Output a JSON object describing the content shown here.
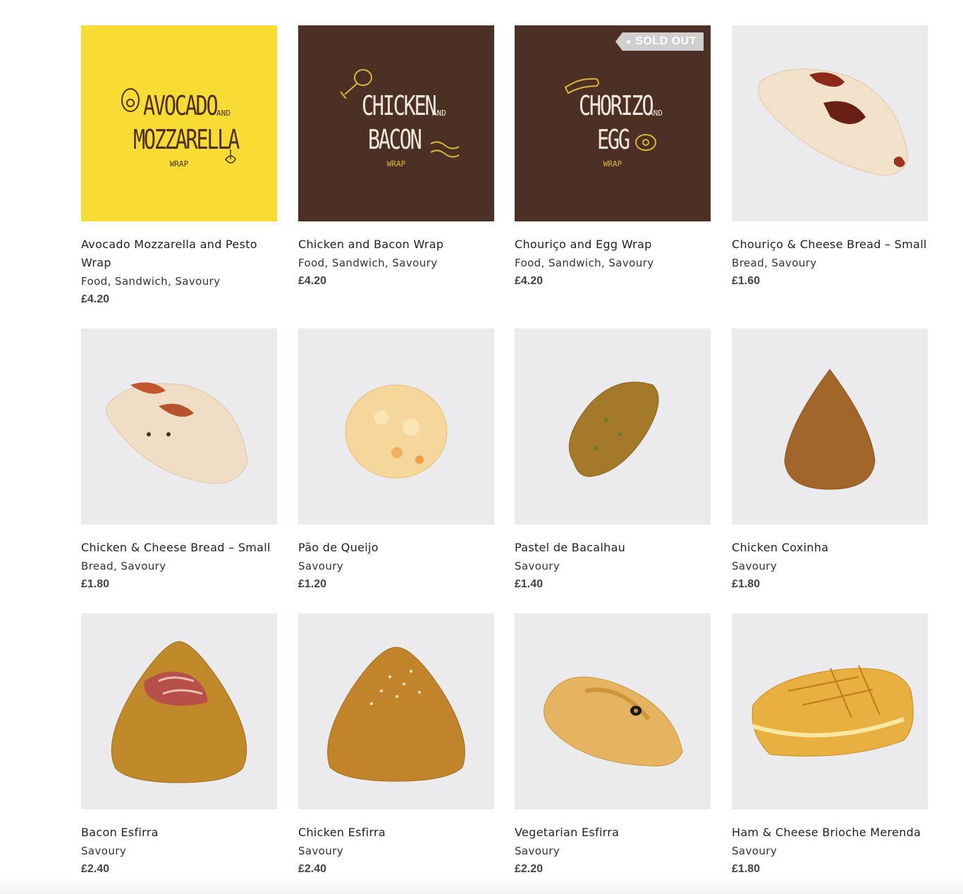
{
  "products": [
    {
      "title": "Avocado Mozzarella and Pesto Wrap",
      "categories": "Food, Sandwich, Savoury",
      "price": "£4.20",
      "art": {
        "line1": "AVOCADO",
        "and": "AND",
        "line2": "MOZZARELLA",
        "wrap": "WRAP"
      }
    },
    {
      "title": "Chicken and Bacon Wrap",
      "categories": "Food, Sandwich, Savoury",
      "price": "£4.20",
      "art": {
        "line1": "CHICKEN",
        "and": "AND",
        "line2": "BACON",
        "wrap": "WRAP"
      }
    },
    {
      "title": "Chouriço and Egg Wrap",
      "categories": "Food, Sandwich, Savoury",
      "price": "£4.20",
      "badge": "SOLD OUT",
      "art": {
        "line1": "CHORIZO",
        "and": "AND",
        "line2": "EGG",
        "wrap": "WRAP"
      }
    },
    {
      "title": "Chouriço & Cheese Bread – Small",
      "categories": "Bread, Savoury",
      "price": "£1.60"
    },
    {
      "title": "Chicken & Cheese Bread – Small",
      "categories": "Bread, Savoury",
      "price": "£1.80"
    },
    {
      "title": "Pão de Queijo",
      "categories": "Savoury",
      "price": "£1.20"
    },
    {
      "title": "Pastel de Bacalhau",
      "categories": "Savoury",
      "price": "£1.40"
    },
    {
      "title": "Chicken Coxinha",
      "categories": "Savoury",
      "price": "£1.80"
    },
    {
      "title": "Bacon Esfirra",
      "categories": "Savoury",
      "price": "£2.40"
    },
    {
      "title": "Chicken Esfirra",
      "categories": "Savoury",
      "price": "£2.40"
    },
    {
      "title": "Vegetarian Esfirra",
      "categories": "Savoury",
      "price": "£2.20"
    },
    {
      "title": "Ham & Cheese Brioche Merenda",
      "categories": "Savoury",
      "price": "£1.80"
    }
  ],
  "colors": {
    "yellow_tile": "#f8dc34",
    "brown_tile": "#4c3026",
    "photo_bg": "#ebebed",
    "art_dark": "#4c3026",
    "art_gold": "#d9b53a"
  }
}
